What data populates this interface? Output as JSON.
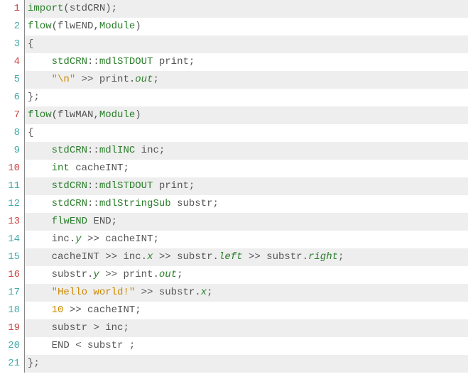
{
  "line_numbers": [
    "1",
    "2",
    "3",
    "4",
    "5",
    "6",
    "7",
    "8",
    "9",
    "10",
    "11",
    "12",
    "13",
    "14",
    "15",
    "16",
    "17",
    "18",
    "19",
    "20",
    "21"
  ],
  "ln_classes": [
    "ln-red",
    "ln-teal",
    "ln-teal",
    "ln-red",
    "ln-teal",
    "ln-teal",
    "ln-red",
    "ln-teal",
    "ln-teal",
    "ln-red",
    "ln-teal",
    "ln-teal",
    "ln-red",
    "ln-teal",
    "ln-teal",
    "ln-red",
    "ln-teal",
    "ln-teal",
    "ln-red",
    "ln-teal",
    "ln-teal"
  ],
  "code": {
    "l1": {
      "import": "import",
      "lp": "(",
      "stdCRN": "stdCRN",
      "rp": ")",
      "sc": ";"
    },
    "l2": {
      "flow": "flow",
      "lp": "(",
      "flwEND": "flwEND",
      "cm": ",",
      "Module": "Module",
      "rp": ")"
    },
    "l3": {
      "brace": "{"
    },
    "l4": {
      "indent": "    ",
      "stdCRN": "stdCRN",
      "sep": "::",
      "mdlSTDOUT": "mdlSTDOUT",
      "sp": " ",
      "print": "print",
      "sc": ";"
    },
    "l5": {
      "indent": "    ",
      "str": "\"\\n\"",
      "sp1": " ",
      "op": ">>",
      "sp2": " ",
      "print": "print",
      "dot": ".",
      "out": "out",
      "sc": ";"
    },
    "l6": {
      "brace": "}",
      "sc": ";"
    },
    "l7": {
      "flow": "flow",
      "lp": "(",
      "flwMAN": "flwMAN",
      "cm": ",",
      "Module": "Module",
      "rp": ")"
    },
    "l8": {
      "brace": "{"
    },
    "l9": {
      "indent": "    ",
      "stdCRN": "stdCRN",
      "sep": "::",
      "mdlINC": "mdlINC",
      "sp": " ",
      "inc": "inc",
      "sc": ";"
    },
    "l10": {
      "indent": "    ",
      "int": "int",
      "sp": " ",
      "cacheINT": "cacheINT",
      "sc": ";"
    },
    "l11": {
      "indent": "    ",
      "stdCRN": "stdCRN",
      "sep": "::",
      "mdlSTDOUT": "mdlSTDOUT",
      "sp": " ",
      "print": "print",
      "sc": ";"
    },
    "l12": {
      "indent": "    ",
      "stdCRN": "stdCRN",
      "sep": "::",
      "mdlStringSub": "mdlStringSub",
      "sp": " ",
      "substr": "substr",
      "sc": ";"
    },
    "l13": {
      "indent": "    ",
      "flwEND": "flwEND",
      "sp": " ",
      "END": "END",
      "sc": ";"
    },
    "l14": {
      "indent": "    ",
      "inc": "inc",
      "dot1": ".",
      "y": "y",
      "sp1": " ",
      "op": ">>",
      "sp2": " ",
      "cacheINT": "cacheINT",
      "sc": ";"
    },
    "l15": {
      "indent": "    ",
      "cacheINT": "cacheINT",
      "sp1": " ",
      "op1": ">>",
      "sp2": " ",
      "inc": "inc",
      "dot1": ".",
      "x": "x",
      "sp3": " ",
      "op2": ">>",
      "sp4": " ",
      "substr1": "substr",
      "dot2": ".",
      "left": "left",
      "sp5": " ",
      "op3": ">>",
      "sp6": " ",
      "substr2": "substr",
      "dot3": ".",
      "right": "right",
      "sc": ";"
    },
    "l16": {
      "indent": "    ",
      "substr": "substr",
      "dot1": ".",
      "y": "y",
      "sp1": " ",
      "op": ">>",
      "sp2": " ",
      "print": "print",
      "dot2": ".",
      "out": "out",
      "sc": ";"
    },
    "l17": {
      "indent": "    ",
      "str": "\"Hello world!\"",
      "sp1": " ",
      "op": ">>",
      "sp2": " ",
      "substr": "substr",
      "dot": ".",
      "x": "x",
      "sc": ";"
    },
    "l18": {
      "indent": "    ",
      "num": "10",
      "sp1": " ",
      "op": ">>",
      "sp2": " ",
      "cacheINT": "cacheINT",
      "sc": ";"
    },
    "l19": {
      "indent": "    ",
      "substr": "substr",
      "sp1": " ",
      "op": ">",
      "sp2": " ",
      "inc": "inc",
      "sc": ";"
    },
    "l20": {
      "indent": "    ",
      "END": "END",
      "sp1": " ",
      "op": "<",
      "sp2": " ",
      "substr": "substr",
      "sp3": " ",
      "sc": ";"
    },
    "l21": {
      "brace": "}",
      "sc": ";"
    }
  }
}
